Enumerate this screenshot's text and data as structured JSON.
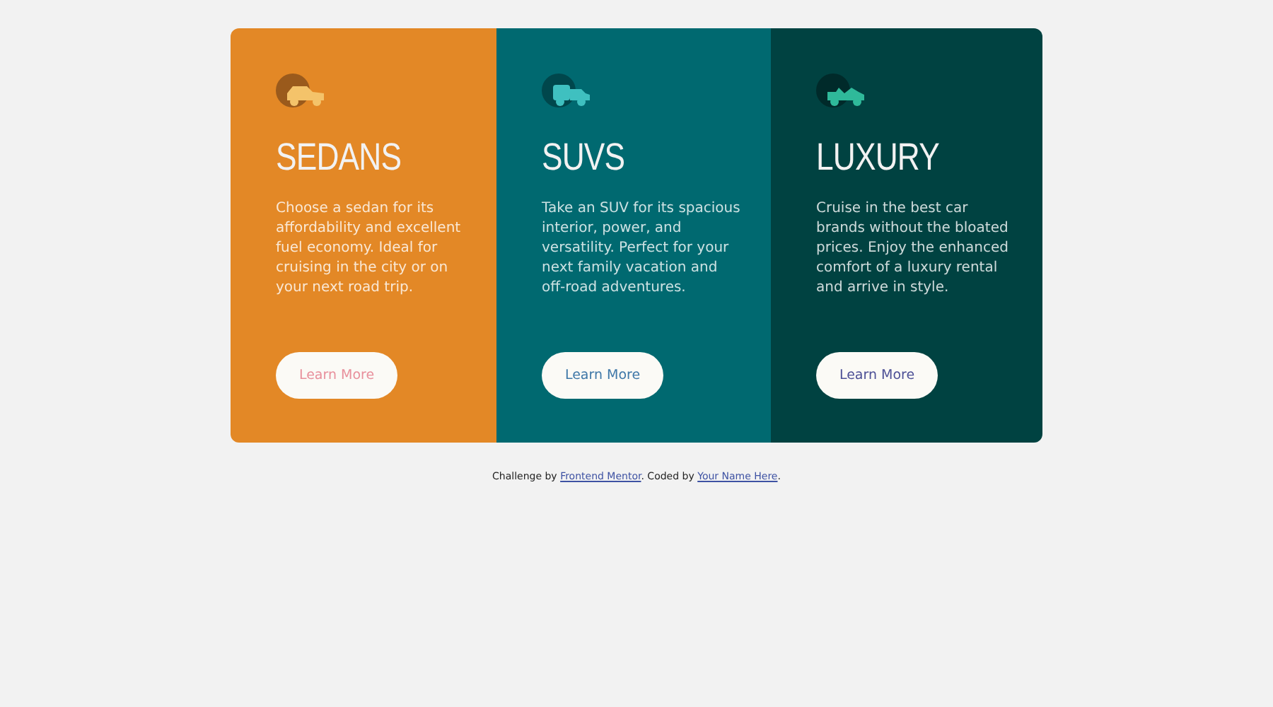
{
  "cards": [
    {
      "kind": "sedan",
      "color": "#e38826",
      "title": "SEDANS",
      "text": "Choose a sedan for its affordability and excellent fuel economy. Ideal for cruising in the city or on your next road trip.",
      "button": "Learn More"
    },
    {
      "kind": "suv",
      "color": "#006970",
      "title": "SUVS",
      "text": "Take an SUV for its spacious interior, power, and versatility. Perfect for your next family vacation and off-road adventures.",
      "button": "Learn More"
    },
    {
      "kind": "luxury",
      "color": "#004241",
      "title": "LUXURY",
      "text": "Cruise in the best car brands without the bloated prices. Enjoy the enhanced comfort of a luxury rental and arrive in style.",
      "button": "Learn More"
    }
  ],
  "footer": {
    "links": [
      "Frontend Mentor",
      "Your Name Here"
    ],
    "parts": [
      "Challenge by ",
      ". Coded by ",
      "."
    ]
  }
}
